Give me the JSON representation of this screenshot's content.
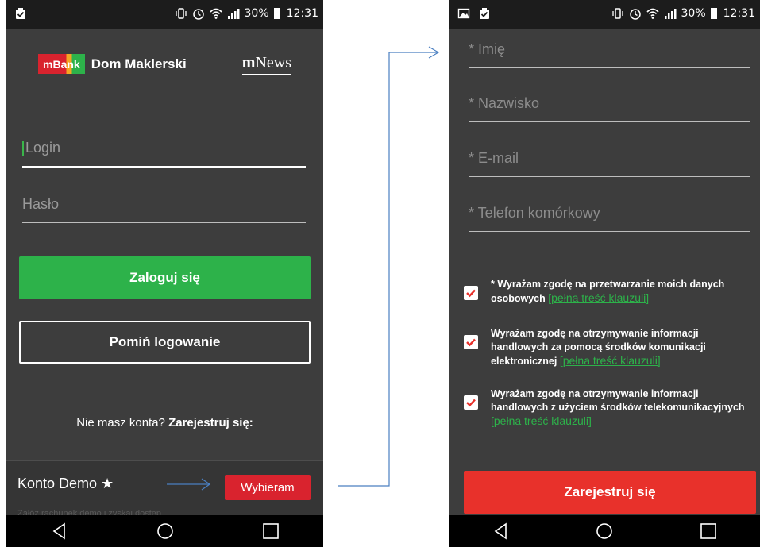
{
  "status_bar": {
    "battery": "30%",
    "time": "12:31"
  },
  "left_screen": {
    "brand_name": "mBank",
    "brand_sub": "Dom Maklerski",
    "news_logo": {
      "prefix": "m",
      "suffix": "News"
    },
    "login_placeholder": "Login",
    "password_placeholder": "Hasło",
    "login_button": "Zaloguj się",
    "skip_button": "Pomiń logowanie",
    "no_account_text": "Nie masz konta?",
    "register_link": "Zarejestruj się:",
    "demo_title": "Konto Demo ★",
    "demo_button": "Wybieram",
    "demo_sub": "Załóż rachunek demo i zyskaj dostęp"
  },
  "right_screen": {
    "fields": [
      "* Imię",
      "* Nazwisko",
      "* E-mail",
      "* Telefon komórkowy"
    ],
    "consents": [
      {
        "text": "* Wyrażam zgodę na przetwarzanie moich danych osobowych",
        "link": "[pełna treść klauzuli]",
        "checked": true
      },
      {
        "text": "Wyrażam zgodę na otrzymywanie informacji handlowych za pomocą środków komunikacji elektronicznej",
        "link": "[pełna treść klauzuli]",
        "checked": true
      },
      {
        "text": "Wyrażam zgodę na otrzymywanie informacji handlowych z użyciem środków telekomunikacyjnych",
        "link": "[pełna treść klauzuli]",
        "checked": true
      }
    ],
    "register_button": "Zarejestruj się"
  },
  "colors": {
    "accent_green": "#2db24a",
    "accent_red": "#e8312b",
    "background": "#3d3d3d",
    "arrow": "#4a7fc1"
  },
  "icons": [
    "clipboard-check-icon",
    "vibrate-icon",
    "alarm-icon",
    "wifi-icon",
    "signal-icon",
    "battery-icon",
    "image-icon",
    "back-icon",
    "home-icon",
    "recents-icon"
  ]
}
